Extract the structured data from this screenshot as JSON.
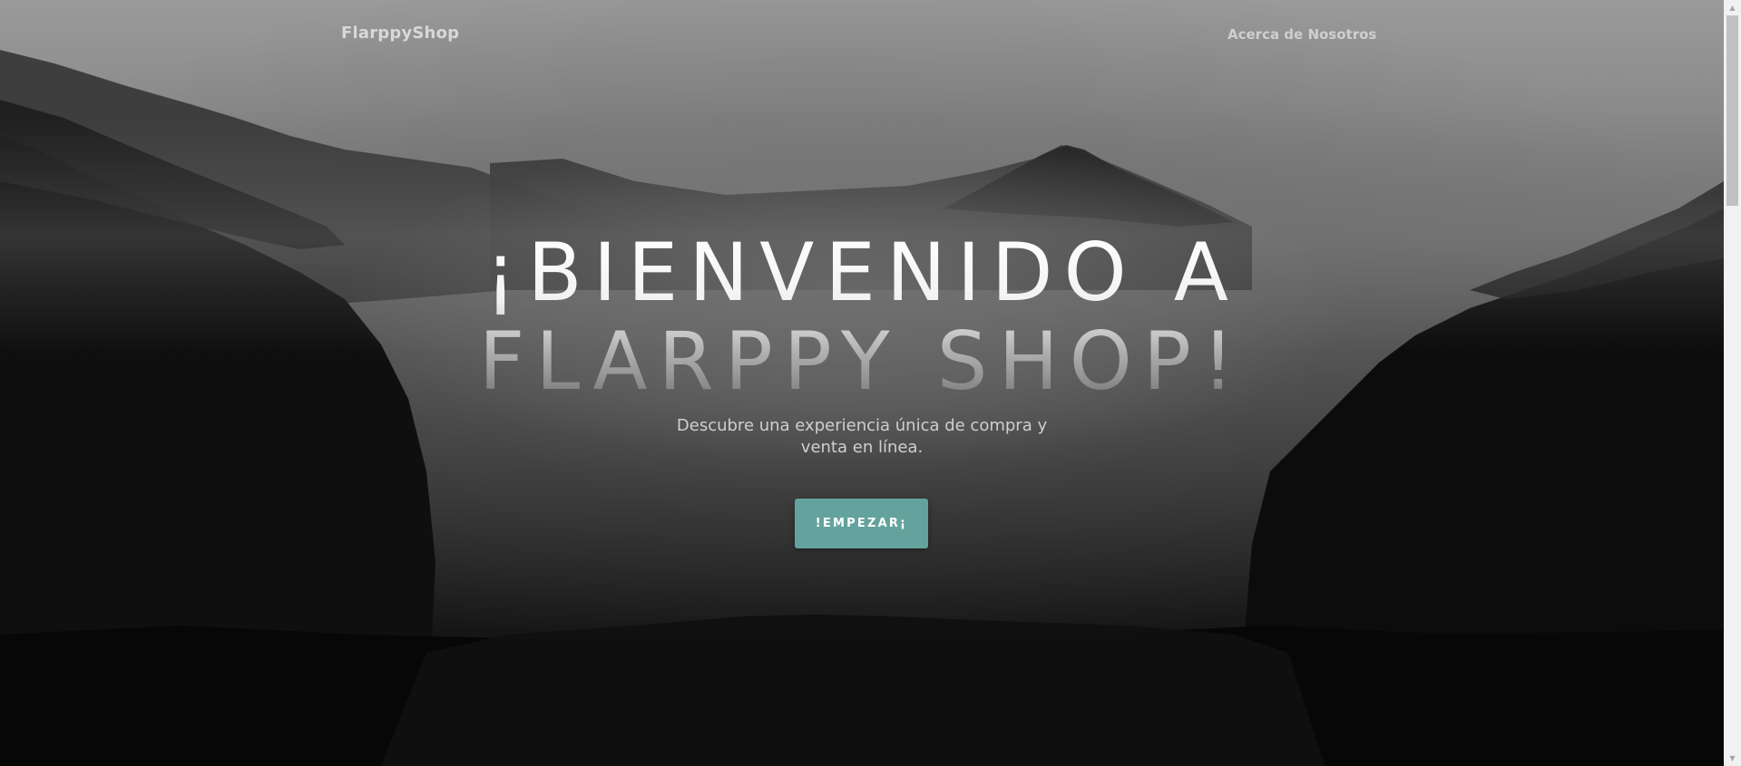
{
  "navbar": {
    "brand": "FlarppyShop",
    "about_link": "Acerca de Nosotros"
  },
  "hero": {
    "title_line1": "¡Bienvenido a",
    "title_line2": "Flarppy Shop!",
    "subtitle": "Descubre una experiencia única de compra y venta en línea.",
    "cta_label": "!EMPEZAR¡"
  },
  "colors": {
    "cta_background": "#64a39d",
    "text_light": "#d8d8d8",
    "sky": "#9a9a9a",
    "forest": "#0b0b0b"
  },
  "icons": {
    "scroll_up": "triangle-up-icon",
    "scroll_down": "triangle-down-icon"
  }
}
